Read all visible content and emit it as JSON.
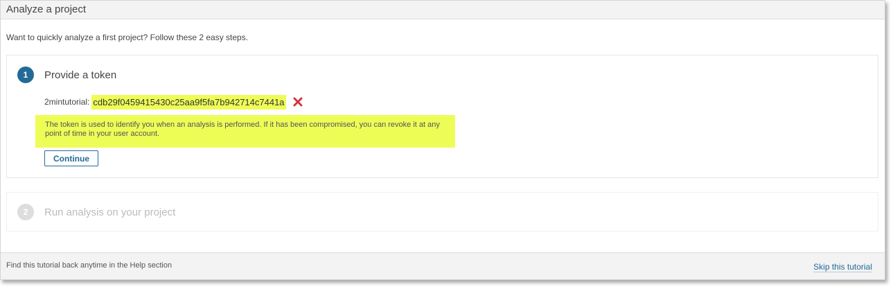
{
  "header": {
    "title": "Analyze a project"
  },
  "intro": {
    "text": "Want to quickly analyze a first project? Follow these 2 easy steps."
  },
  "steps": [
    {
      "number": "1",
      "title": "Provide a token",
      "token_label": "2mintutorial:",
      "token_value": "cdb29f0459415430c25aa9f5fa7b942714c7441a",
      "note": "The token is used to identify you when an analysis is performed. If it has been compromised, you can revoke it at any point of time in your user account.",
      "continue_label": "Continue"
    },
    {
      "number": "2",
      "title": "Run analysis on your project"
    }
  ],
  "footer": {
    "text": "Find this tutorial back anytime in the Help section",
    "skip_label": "Skip this tutorial"
  },
  "icons": {
    "revoke": "close-icon"
  },
  "colors": {
    "accent": "#236a97",
    "highlight": "#eefc56",
    "revoke": "#d4333f"
  }
}
